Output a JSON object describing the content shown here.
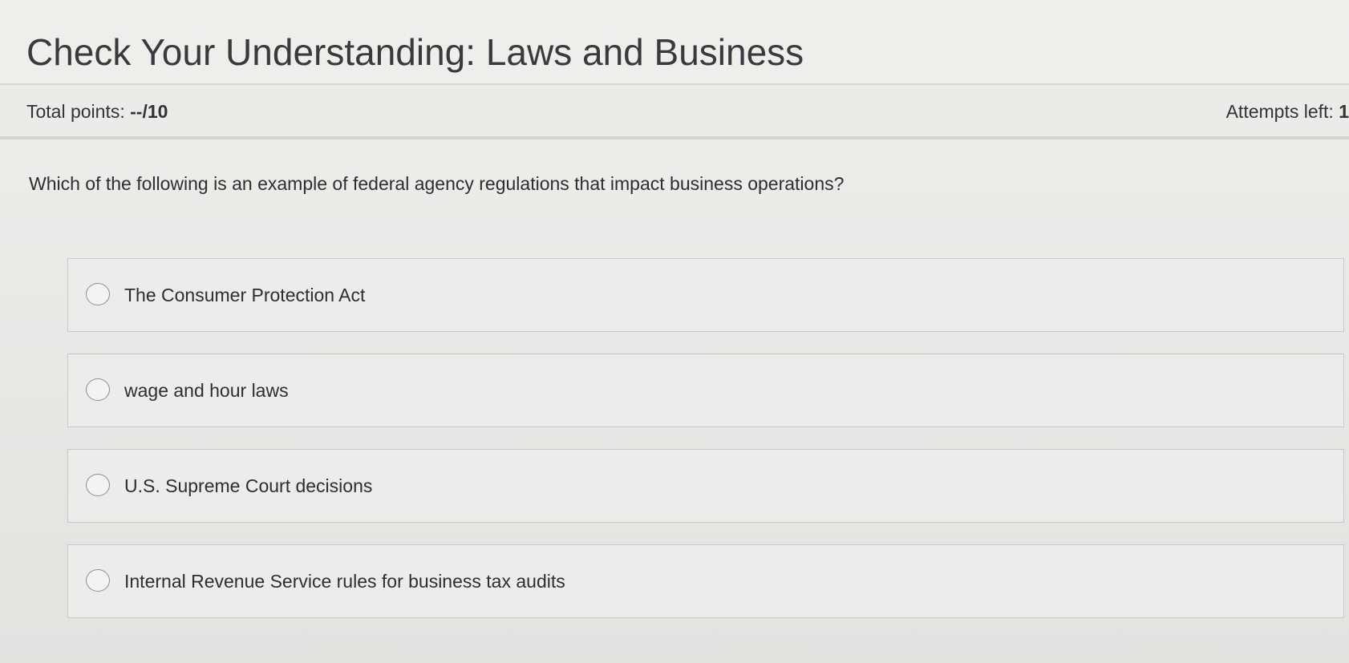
{
  "quiz": {
    "title": "Check Your Understanding: Laws and Business",
    "total_points_label": "Total points: ",
    "total_points_value": "--/10",
    "attempts_label": "Attempts left: ",
    "attempts_value": "1"
  },
  "question": {
    "text": "Which of the following is an example of federal agency regulations that impact business operations?",
    "options": [
      {
        "label": "The Consumer Protection Act",
        "selected": false
      },
      {
        "label": "wage and hour laws",
        "selected": false
      },
      {
        "label": "U.S. Supreme Court decisions",
        "selected": false
      },
      {
        "label": "Internal Revenue Service rules for business tax audits",
        "selected": false
      }
    ]
  }
}
